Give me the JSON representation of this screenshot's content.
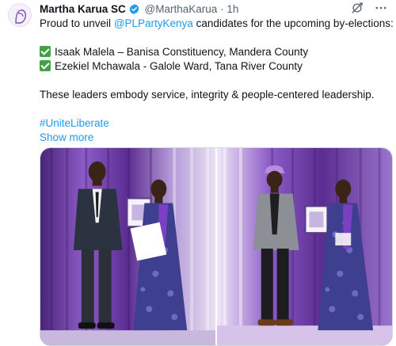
{
  "author": {
    "name": "Martha Karua SC",
    "handle": "@MarthaKarua",
    "separator": "·",
    "time": "1h",
    "verified_icon": "verified-badge-icon",
    "avatar_icon": "avatar-portrait"
  },
  "actions": {
    "grok_icon": "grok-icon",
    "more_icon": "more-dots-icon"
  },
  "tweet": {
    "intro_prefix": "Proud to unveil ",
    "mention": "@PLPartyKenya",
    "intro_suffix": " candidates for the upcoming by-elections:",
    "candidates": [
      "Isaak Malela – Banisa Constituency, Mandera County",
      "Ezekiel Mchawala - Galole Ward, Tana River County"
    ],
    "closing": "These leaders embody service, integrity & people-centered leadership.",
    "hashtag": "#UniteLiberate",
    "show_more": "Show more"
  },
  "colors": {
    "link": "#1d9bf0",
    "verified": "#1d9bf0",
    "check": "#43a047",
    "curtain_purple": "#6b3fa0"
  },
  "media": {
    "photos": [
      {
        "name": "photo-1"
      },
      {
        "name": "photo-2"
      }
    ]
  }
}
